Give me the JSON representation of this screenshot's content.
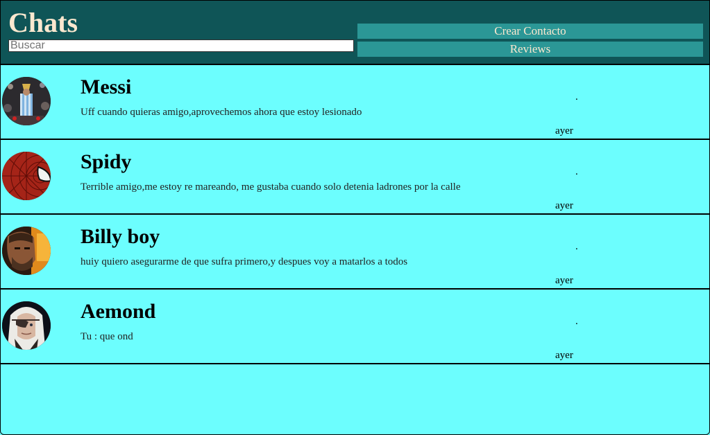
{
  "app": {
    "title": "Chats",
    "search_placeholder": "Buscar",
    "buttons": {
      "create_contact": "Crear Contacto",
      "reviews": "Reviews"
    },
    "colors": {
      "header_bg": "#0f5557",
      "title_text": "#fbe8cf",
      "button_bg": "#2b9796",
      "list_bg": "#6cfefe"
    }
  },
  "chats": [
    {
      "name": "Messi",
      "message": "Uff cuando quieras amigo,aprovechemos ahora que estoy lesionado",
      "dot": ".",
      "time": "ayer",
      "avatar_icon": "messi-trophy-avatar"
    },
    {
      "name": "Spidy",
      "message": "Terrible amigo,me estoy re mareando, me gustaba cuando solo detenia ladrones por la calle",
      "dot": ".",
      "time": "ayer",
      "avatar_icon": "spiderman-mask-avatar"
    },
    {
      "name": "Billy boy",
      "message": "huiy quiero asegurarme de que sufra primero,y despues voy a matarlos a todos",
      "dot": ".",
      "time": "ayer",
      "avatar_icon": "billy-boy-avatar"
    },
    {
      "name": "Aemond",
      "message": "Tu : que ond",
      "dot": ".",
      "time": "ayer",
      "avatar_icon": "aemond-eyepatch-avatar"
    }
  ]
}
